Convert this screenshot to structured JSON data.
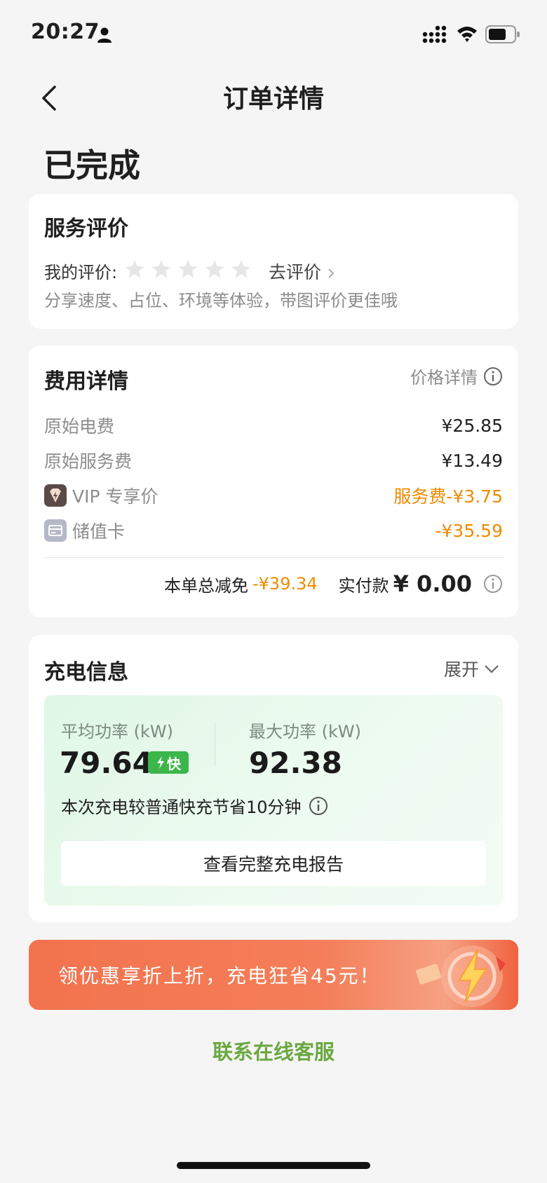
{
  "status_bar": {
    "time": "20:27"
  },
  "nav": {
    "title": "订单详情"
  },
  "order_status": "已完成",
  "review": {
    "title": "服务评价",
    "my_rating_label": "我的评价:",
    "stars_filled": 0,
    "stars_total": 5,
    "go_review": "去评价",
    "hint": "分享速度、占位、环境等体验，带图评价更佳哦"
  },
  "fees": {
    "title": "费用详情",
    "price_detail_link": "价格详情",
    "rows": [
      {
        "label": "原始电费",
        "value": "¥25.85"
      },
      {
        "label": "原始服务费",
        "value": "¥13.49"
      },
      {
        "label": "VIP 专享价",
        "value": "服务费-¥3.75"
      },
      {
        "label": "储值卡",
        "value": "-¥35.59"
      }
    ],
    "total_discount_label": "本单总减免",
    "total_discount_value": "-¥39.34",
    "paid_label": "实付款",
    "paid_amount": "¥ 0.00"
  },
  "charging": {
    "title": "充电信息",
    "expand": "展开",
    "avg_power_label": "平均功率 (kW)",
    "avg_power_value": "79.64",
    "fast_badge": "快",
    "max_power_label": "最大功率 (kW)",
    "max_power_value": "92.38",
    "saving_text": "本次充电较普通快充节省10分钟",
    "report_button": "查看完整充电报告"
  },
  "promo": {
    "text": "领优惠享折上折，充电狂省45元！"
  },
  "service_link": "联系在线客服",
  "colors": {
    "accent_orange": "#f08a00",
    "green": "#6aa841",
    "fast_badge": "#3cb54a",
    "promo": "#f2734e"
  }
}
